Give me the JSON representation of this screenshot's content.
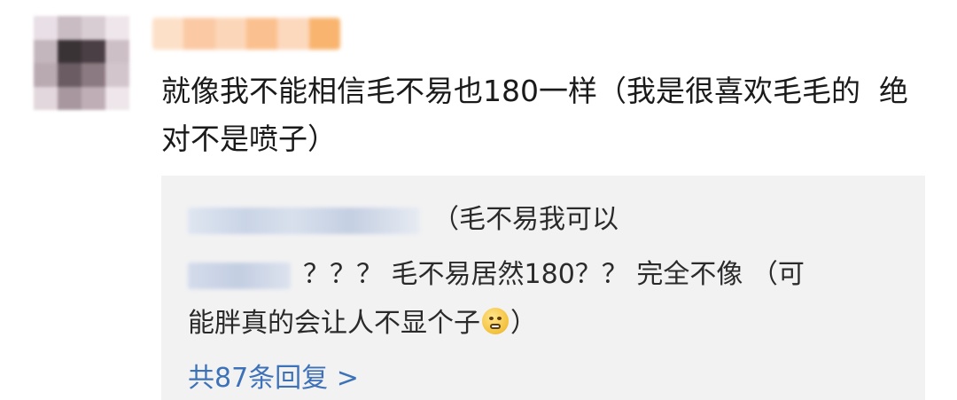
{
  "comment": {
    "text": "就像我不能相信毛不易也180一样（我是很喜欢毛毛的  绝对不是喷子）"
  },
  "replies": [
    {
      "text": "（毛不易我可以"
    },
    {
      "text": "？？？ 毛不易居然180？？ 完全不像 （可"
    },
    {
      "text": "能胖真的会让人不显个子",
      "suffix": "）"
    }
  ],
  "emoji": {
    "icon": "tongue-tied-emoji-icon"
  },
  "more_replies": {
    "label": "共87条回复 >"
  },
  "colors": {
    "link": "#3d72b8",
    "reply_bg": "#f2f2f3",
    "text": "#1a1a1a"
  }
}
